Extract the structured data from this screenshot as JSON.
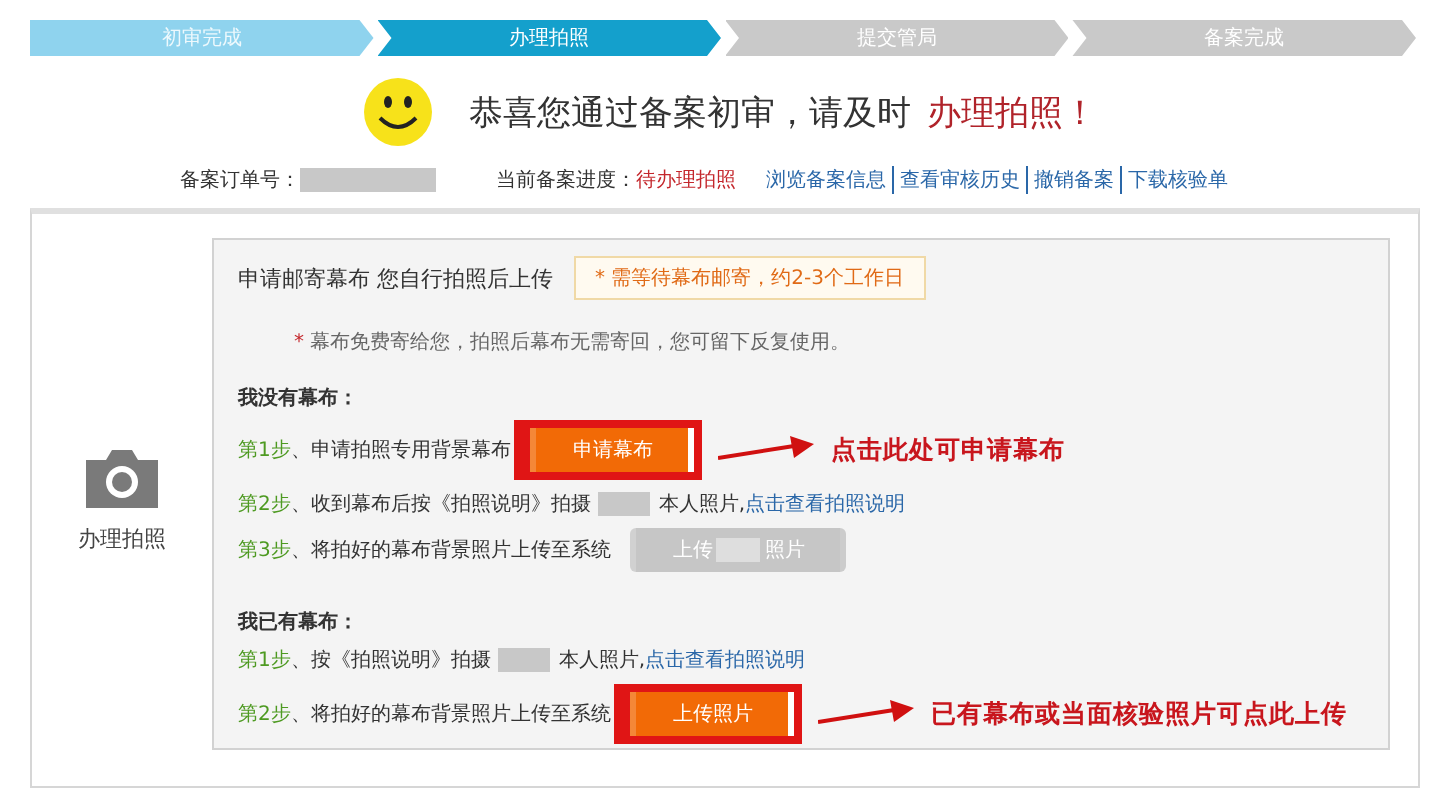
{
  "progress": [
    {
      "label": "初审完成",
      "completed": true,
      "selected": false
    },
    {
      "label": "办理拍照",
      "completed": false,
      "selected": true
    },
    {
      "label": "提交管局",
      "completed": false,
      "selected": false
    },
    {
      "label": "备案完成",
      "completed": false,
      "selected": false
    }
  ],
  "headline": {
    "text": "恭喜您通过备案初审，请及时",
    "emphasis": "办理拍照！"
  },
  "info": {
    "order_label": "备案订单号：",
    "order_redacted": true,
    "progress_label": "当前备案进度：",
    "progress_value": "待办理拍照",
    "links": [
      "浏览备案信息",
      "查看审核历史",
      "撤销备案",
      "下载核验单"
    ]
  },
  "side": {
    "label": "办理拍照"
  },
  "panel": {
    "title": "申请邮寄幕布 您自行拍照后上传",
    "notice": "* 需等待幕布邮寄，约2-3个工作日",
    "note_mark": "*",
    "note": "幕布免费寄给您，拍照后幕布无需寄回，您可留下反复使用。",
    "sections": [
      {
        "heading": "我没有幕布：",
        "steps": [
          {
            "step": "第1步",
            "text": "、申请拍照专用背景幕布",
            "button": {
              "label": "申请幕布",
              "disabled": false,
              "highlighted": true,
              "callout": "点击此处可申请幕布"
            }
          },
          {
            "step": "第2步",
            "text": "、收到幕布后按《拍照说明》拍摄",
            "redacted": true,
            "after": "本人照片,",
            "link": "点击查看拍照说明"
          },
          {
            "step": "第3步",
            "text": "、将拍好的幕布背景照片上传至系统",
            "button": {
              "label": "上传",
              "label_after": "照片",
              "disabled": true,
              "highlighted": false
            }
          }
        ]
      },
      {
        "heading": "我已有幕布：",
        "steps": [
          {
            "step": "第1步",
            "text": "、按《拍照说明》拍摄",
            "redacted": true,
            "after": "本人照片,",
            "link": "点击查看拍照说明"
          },
          {
            "step": "第2步",
            "text": "、将拍好的幕布背景照片上传至系统",
            "button": {
              "label": "上传照片",
              "disabled": false,
              "highlighted": true,
              "callout": "已有幕布或当面核验照片可点此上传"
            }
          }
        ]
      }
    ]
  }
}
